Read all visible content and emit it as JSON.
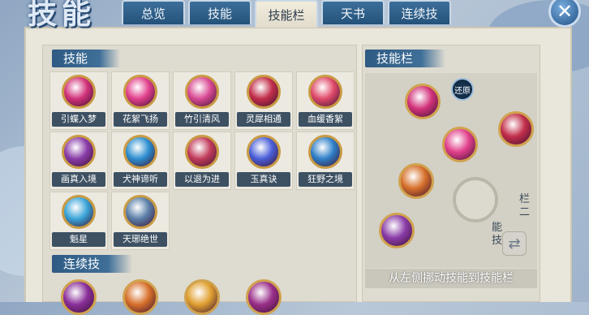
{
  "window": {
    "title": "技能",
    "close_glyph": "✕"
  },
  "tabs": [
    {
      "label": "总览",
      "active": false
    },
    {
      "label": "技能",
      "active": false
    },
    {
      "label": "技能栏",
      "active": true
    },
    {
      "label": "天书",
      "active": false
    },
    {
      "label": "连续技",
      "active": false
    }
  ],
  "skills_section": {
    "title": "技能"
  },
  "skills": [
    {
      "label": "引蝶入梦",
      "color": "#d2327a"
    },
    {
      "label": "花絮飞扬",
      "color": "#e2408c"
    },
    {
      "label": "竹引清风",
      "color": "#d94a94"
    },
    {
      "label": "灵犀相通",
      "color": "#c22e4a"
    },
    {
      "label": "血缓香絮",
      "color": "#e04a6a"
    },
    {
      "label": "画真入境",
      "color": "#8a3ca8"
    },
    {
      "label": "犬神谛听",
      "color": "#2d8fd0"
    },
    {
      "label": "以退为进",
      "color": "#c23c5c"
    },
    {
      "label": "玉真诀",
      "color": "#4a5fd8"
    },
    {
      "label": "狂野之境",
      "color": "#2f7fc8"
    },
    {
      "label": "魁星",
      "color": "#3aa4d8"
    },
    {
      "label": "天琊绝世",
      "color": "#5a7fa8"
    }
  ],
  "combo_section": {
    "title": "连续技"
  },
  "combo_skills": [
    {
      "color": "#8a2f9a"
    },
    {
      "color": "#d7702a"
    },
    {
      "color": "#e0a030"
    },
    {
      "color": "#9a2f8a"
    }
  ],
  "skillbar": {
    "title": "技能栏",
    "restore_label": "还原",
    "side_text_a": "栏二",
    "side_text_b": "能技",
    "swap_glyph": "⇄",
    "hint": "从左侧挪动技能到技能栏",
    "slots": [
      {
        "color": "#d2327a"
      },
      {
        "color": "#c22e4a"
      },
      {
        "color": "#e2408c"
      },
      {
        "color": "#d7702a"
      },
      {
        "color": "#8a3ca8"
      }
    ]
  }
}
